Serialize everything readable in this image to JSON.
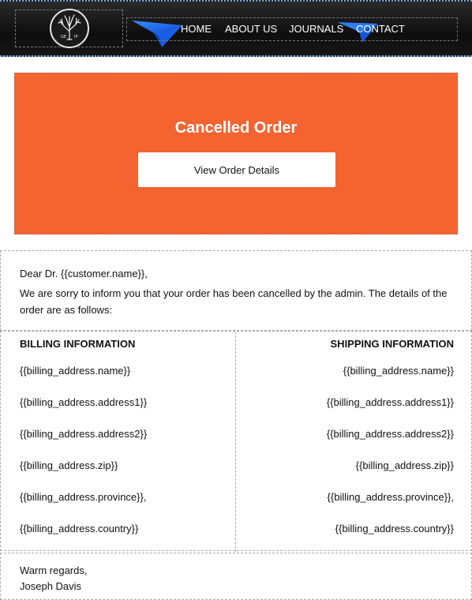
{
  "header": {
    "logo_icon": "tree-logo-icon",
    "logo_text_left": "GE",
    "logo_text_right": "IP",
    "nav": [
      "HOME",
      "ABOUT US",
      "JOURNALS",
      "CONTACT"
    ],
    "colors": {
      "background": "#161616",
      "plane": "#1f6ef0"
    }
  },
  "hero": {
    "title": "Cancelled Order",
    "button_label": "View Order Details",
    "background": "#f46431"
  },
  "message": {
    "greeting": "Dear Dr. {{customer.name}},",
    "body": "We are sorry to inform you that your order has been cancelled by the admin. The details of the order are as follows:"
  },
  "billing": {
    "heading": "BILLING INFORMATION",
    "lines": [
      "{{billing_address.name}}",
      "{{billing_address.address1}}",
      "{{billing_address.address2}}",
      "{{billing_address.zip}}",
      "{{billing_address.province}},",
      "{{billing_address.country}}"
    ]
  },
  "shipping": {
    "heading": "SHIPPING INFORMATION",
    "lines": [
      "{{billing_address.name}}",
      "{{billing_address.address1}}",
      "{{billing_address.address2}}",
      "{{billing_address.zip}}",
      "{{billing_address.province}},",
      "{{billing_address.country}}"
    ]
  },
  "closing": {
    "line1": "Warm regards,",
    "line2": "Joseph Davis"
  }
}
